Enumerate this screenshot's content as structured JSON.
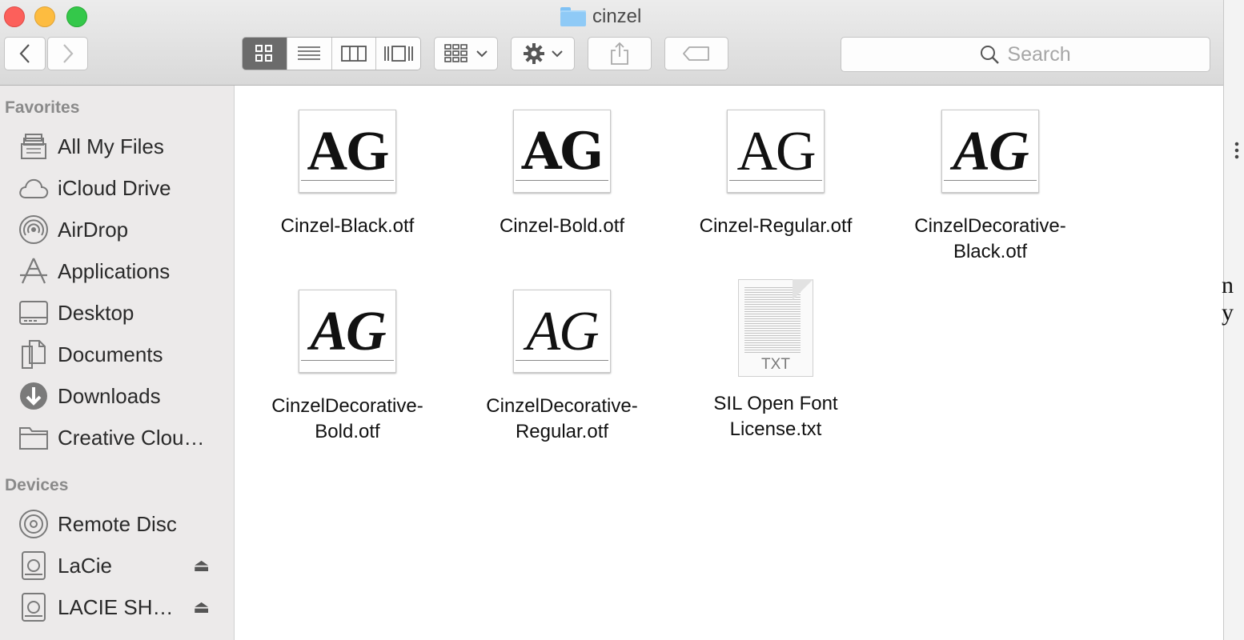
{
  "window": {
    "title": "cinzel"
  },
  "toolbar": {
    "back_icon": "chevron-left-icon",
    "forward_icon": "chevron-right-icon",
    "views": [
      "icon-view",
      "list-view",
      "column-view",
      "cover-flow-view"
    ],
    "search_placeholder": "Search"
  },
  "sidebar": {
    "favorites_label": "Favorites",
    "favorites": [
      {
        "label": "All My Files",
        "icon": "all-files-icon"
      },
      {
        "label": "iCloud Drive",
        "icon": "cloud-icon"
      },
      {
        "label": "AirDrop",
        "icon": "airdrop-icon"
      },
      {
        "label": "Applications",
        "icon": "applications-icon"
      },
      {
        "label": "Desktop",
        "icon": "desktop-icon"
      },
      {
        "label": "Documents",
        "icon": "documents-icon"
      },
      {
        "label": "Downloads",
        "icon": "downloads-icon"
      },
      {
        "label": "Creative Clou…",
        "icon": "folder-icon"
      }
    ],
    "devices_label": "Devices",
    "devices": [
      {
        "label": "Remote Disc",
        "icon": "disc-icon"
      },
      {
        "label": "LaCie",
        "icon": "drive-icon"
      },
      {
        "label": "LACIE SH…",
        "icon": "drive-icon"
      }
    ]
  },
  "files": [
    {
      "line1": "Cinzel-Black.otf",
      "line2": ""
    },
    {
      "line1": "Cinzel-Bold.otf",
      "line2": ""
    },
    {
      "line1": "Cinzel-Regular.otf",
      "line2": ""
    },
    {
      "line1": "CinzelDecorative-",
      "line2": "Black.otf"
    },
    {
      "line1": "CinzelDecorative-",
      "line2": "Bold.otf"
    },
    {
      "line1": "CinzelDecorative-",
      "line2": "Regular.otf"
    },
    {
      "line1": "SIL Open Font",
      "line2": "License.txt"
    }
  ],
  "thumb_text": "AG",
  "txt_ext": "TXT",
  "edge_text": "n y"
}
